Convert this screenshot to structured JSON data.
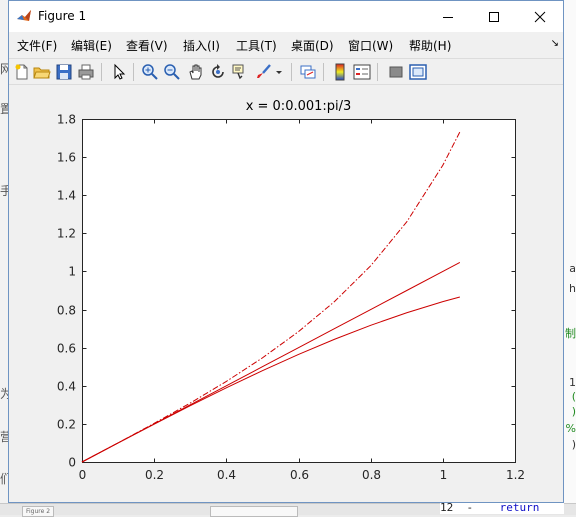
{
  "window": {
    "title": "Figure 1",
    "accent_color": "#6f94c2"
  },
  "menu": {
    "items": [
      "文件(F)",
      "编辑(E)",
      "查看(V)",
      "插入(I)",
      "工具(T)",
      "桌面(D)",
      "窗口(W)",
      "帮助(H)"
    ]
  },
  "toolbar": {
    "buttons": [
      "new-figure-icon",
      "open-file-icon",
      "save-icon",
      "print-icon",
      "select-arrow-icon",
      "zoom-in-icon",
      "zoom-out-icon",
      "pan-hand-icon",
      "rotate-3d-icon",
      "data-cursor-icon",
      "brush-icon",
      "brush-dropdown-icon",
      "link-plot-icon",
      "colorbar-icon",
      "legend-icon",
      "hide-plot-tools-icon",
      "show-plot-tools-icon"
    ]
  },
  "background": {
    "left_glyphs": [
      "网",
      "置",
      "手",
      "为",
      "营",
      "们"
    ],
    "right_glyphs": [
      "a",
      "h",
      "制",
      "1",
      "(",
      ")",
      "%",
      ")"
    ],
    "code_line_number": "12",
    "code_text": "return",
    "taskbar_tab": "Figure 2"
  },
  "chart_data": {
    "type": "line",
    "title": "x = 0:0.001:pi/3",
    "xlabel": "",
    "ylabel": "",
    "xlim": [
      0,
      1.2
    ],
    "ylim": [
      0,
      1.8
    ],
    "xticks": [
      "0",
      "0.2",
      "0.4",
      "0.6",
      "0.8",
      "1",
      "1.2"
    ],
    "yticks": [
      "0",
      "0.2",
      "0.4",
      "0.6",
      "0.8",
      "1",
      "1.2",
      "1.4",
      "1.6",
      "1.8"
    ],
    "grid": false,
    "line_color": "#cc0000",
    "x_range": [
      0,
      1.0472
    ],
    "series": [
      {
        "style": "solid",
        "x": [
          0,
          0.1,
          0.2,
          0.3,
          0.4,
          0.5,
          0.6,
          0.7,
          0.8,
          0.9,
          1.0,
          1.0472
        ],
        "y": [
          0,
          0.1,
          0.2,
          0.3,
          0.4,
          0.5,
          0.6,
          0.7,
          0.8,
          0.9,
          1.0,
          1.0472
        ]
      },
      {
        "style": "solid",
        "x": [
          0,
          0.1,
          0.2,
          0.3,
          0.4,
          0.5,
          0.6,
          0.7,
          0.8,
          0.9,
          1.0,
          1.0472
        ],
        "y": [
          0,
          0.0998,
          0.1987,
          0.2955,
          0.3894,
          0.4794,
          0.5646,
          0.6442,
          0.7174,
          0.7833,
          0.8415,
          0.866
        ]
      },
      {
        "style": "dashdot",
        "x": [
          0,
          0.1,
          0.2,
          0.3,
          0.4,
          0.5,
          0.6,
          0.7,
          0.8,
          0.9,
          1.0,
          1.0472
        ],
        "y": [
          0,
          0.1003,
          0.2027,
          0.3093,
          0.4228,
          0.5463,
          0.6841,
          0.8423,
          1.0296,
          1.2602,
          1.5574,
          1.7321
        ]
      }
    ]
  }
}
